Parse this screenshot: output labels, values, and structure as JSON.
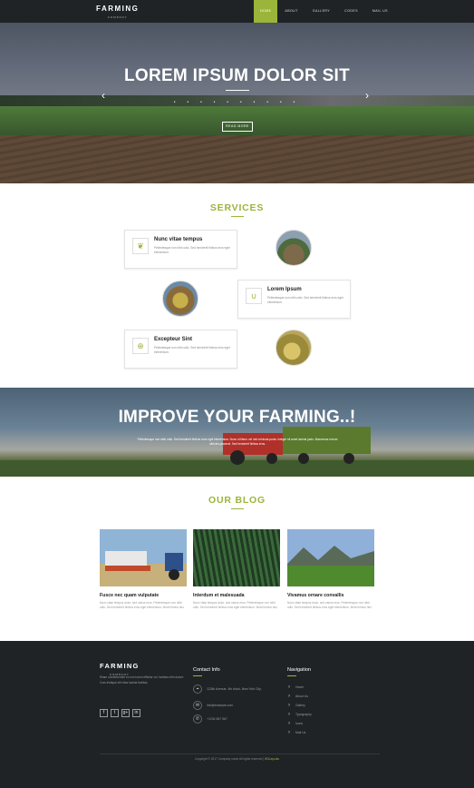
{
  "brand": {
    "name": "FARMING",
    "tagline": "COMPANY"
  },
  "nav": {
    "items": [
      {
        "label": "HOME",
        "active": true
      },
      {
        "label": "ABOUT",
        "active": false
      },
      {
        "label": "GALLERY",
        "active": false
      },
      {
        "label": "CODES",
        "active": false
      },
      {
        "label": "MAIL US",
        "active": false
      }
    ]
  },
  "hero": {
    "title": "LOREM IPSUM DOLOR SIT",
    "button": "READ MORE",
    "prev_icon": "chevron-left-icon",
    "next_icon": "chevron-right-icon"
  },
  "services": {
    "title": "SERVICES",
    "items": [
      {
        "title": "Nunc vitae tempus",
        "text": "Pellentesque non nibh odio. Sed hendrerit finibus eros eget elementum.",
        "icon": "leaf-icon"
      },
      {
        "title": "Lorem Ipsum",
        "text": "Pellentesque non nibh odio. Sed hendrerit finibus eros eget elementum.",
        "icon": "magnet-icon"
      },
      {
        "title": "Excepteur Sint",
        "text": "Pellentesque non nibh odio. Sed hendrerit finibus eros eget elementum.",
        "icon": "plus-icon"
      }
    ]
  },
  "banner": {
    "title": "IMPROVE YOUR FARMING..!",
    "text": "Pellentesque non nibh odio. Sed hendrerit finibus eros eget elementum. Nunc id libero vel nisl vehicula porta. Integer sit amet lacinia justo. Maecenas rutrum ultricies placerat. Sed hendrerit finibus eros."
  },
  "blog": {
    "title": "OUR BLOG",
    "posts": [
      {
        "title": "Fusce nec quam vulputate",
        "text": "Nunc vitae tempus dolor, sed varius eros. Pellentesque non nibh odio. Sed hendrerit finibus eros eget elementum. Morbi lectus nisi."
      },
      {
        "title": "Interdum et malesuada",
        "text": "Nunc vitae tempus dolor, sed varius eros. Pellentesque non nibh odio. Sed hendrerit finibus eros eget elementum. Morbi lectus nisi."
      },
      {
        "title": "Vivamus ornare convallis",
        "text": "Nunc vitae tempus dolor, sed varius eros. Pellentesque non nibh odio. Sed hendrerit finibus eros eget elementum. Morbi lectus nisi."
      }
    ]
  },
  "footer": {
    "description": "Etiam condimentum ex non lorem efficitur vel, facilisis nibh dolore. Cras tristique elit vitae lacinia facilisis.",
    "social": [
      "f",
      "t",
      "g+",
      "in"
    ],
    "contact": {
      "title": "Contact Info",
      "rows": [
        {
          "icon": "location-icon",
          "text": "1234k Avenue, 4th block, New York City."
        },
        {
          "icon": "mail-icon",
          "text": "info@example.com"
        },
        {
          "icon": "phone-icon",
          "text": "+1234 567 567"
        }
      ]
    },
    "navigation": {
      "title": "Navigation",
      "items": [
        "Home",
        "About Us",
        "Gallery",
        "Typography",
        "Icons",
        "Mail Us"
      ]
    },
    "copyright": "Copyright © 2017 Company name All rights reserved |",
    "copyright_link": "W3Layouts"
  },
  "colors": {
    "accent": "#9bb53a",
    "dark": "#1f2326"
  }
}
